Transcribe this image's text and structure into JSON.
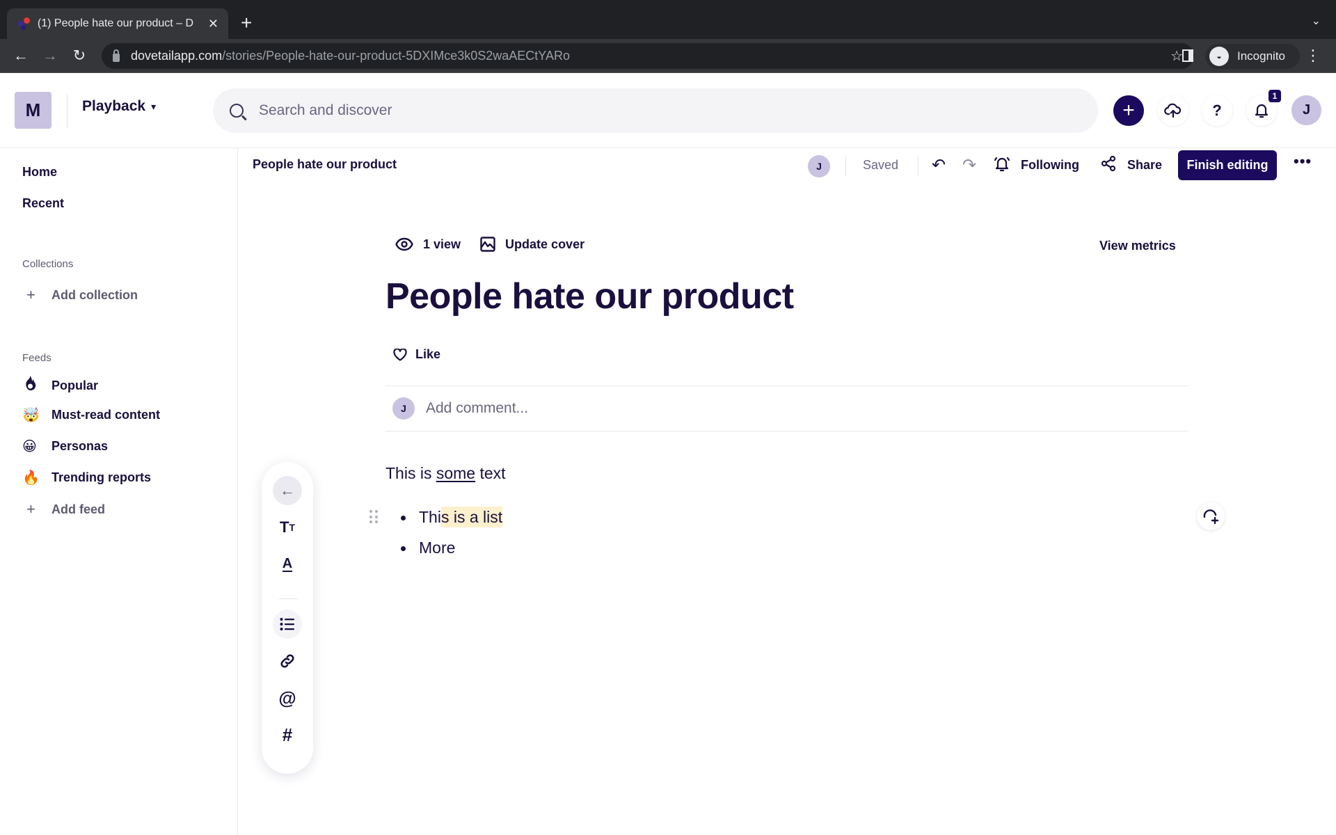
{
  "browser": {
    "tab_title": "(1) People hate our product – D",
    "url_host": "dovetailapp.com",
    "url_path": "/stories/People-hate-our-product-5DXIMce3k0S2waAECtYARo",
    "profile_label": "Incognito"
  },
  "header": {
    "workspace_initial": "M",
    "workspace_name": "Playback",
    "search_placeholder": "Search and discover",
    "notification_count": "1",
    "user_initial": "J"
  },
  "sidebar": {
    "nav": [
      {
        "label": "Home"
      },
      {
        "label": "Recent"
      }
    ],
    "collections_heading": "Collections",
    "add_collection_label": "Add collection",
    "feeds_heading": "Feeds",
    "feeds": [
      {
        "label": "Popular",
        "icon": "popular-flame-icon"
      },
      {
        "label": "Must-read content",
        "icon": "exploding-head-emoji"
      },
      {
        "label": "Personas",
        "icon": "grinning-face-emoji"
      },
      {
        "label": "Trending reports",
        "icon": "fire-emoji"
      }
    ],
    "add_feed_label": "Add feed"
  },
  "toolbar": {
    "breadcrumb": "People hate our product",
    "collaborator_initial": "J",
    "save_status": "Saved",
    "following_label": "Following",
    "share_label": "Share",
    "finish_label": "Finish editing"
  },
  "document": {
    "views_label": "1 view",
    "update_cover_label": "Update cover",
    "view_metrics_label": "View metrics",
    "title": "People hate our product",
    "like_label": "Like",
    "comment_avatar_initial": "J",
    "comment_placeholder": "Add comment...",
    "paragraph": {
      "before": "This is ",
      "underlined": "some",
      "after": " text"
    },
    "list_items": [
      {
        "plain": "Thi",
        "highlighted": "s is a list"
      },
      {
        "plain": "More",
        "highlighted": ""
      }
    ]
  },
  "colors": {
    "brand": "#1b0a5e",
    "avatar_bg": "#c9c2e0",
    "highlight": "#fdf0cc"
  }
}
